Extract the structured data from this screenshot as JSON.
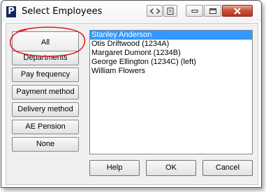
{
  "window": {
    "app_icon_letter": "P",
    "title": "Select Employees"
  },
  "filters": [
    {
      "label": "All"
    },
    {
      "label": "Departments"
    },
    {
      "label": "Pay frequency"
    },
    {
      "label": "Payment method"
    },
    {
      "label": "Delivery method"
    },
    {
      "label": "AE Pension"
    },
    {
      "label": "None"
    }
  ],
  "employees": [
    {
      "label": "Stanley Anderson",
      "selected": true
    },
    {
      "label": "Otis Driftwood (1234A)",
      "selected": false
    },
    {
      "label": "Margaret Dumont (1234B)",
      "selected": false
    },
    {
      "label": "George Ellington (1234C) (left)",
      "selected": false
    },
    {
      "label": "William Flowers",
      "selected": false
    }
  ],
  "footer": {
    "help_label": "Help",
    "ok_label": "OK",
    "cancel_label": "Cancel"
  },
  "colors": {
    "selection": "#3399ff",
    "annotation": "#e31e24",
    "app_icon": "#14285a",
    "close_button": "#c9553f"
  }
}
